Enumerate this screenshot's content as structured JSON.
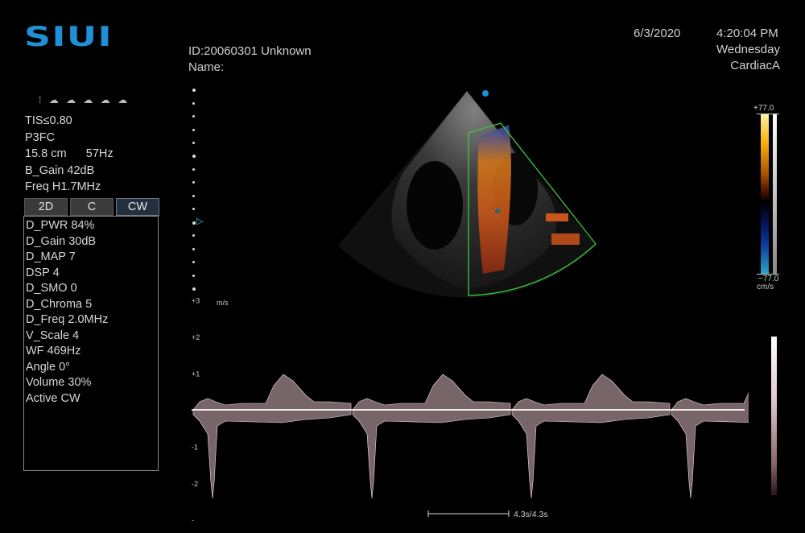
{
  "brand": {
    "logo_text": "SIUI"
  },
  "patient": {
    "id_line": "ID:20060301   Unknown",
    "name_line": "Name:"
  },
  "datetime": {
    "date": "6/3/2020",
    "time": "4:20:04 PM",
    "weekday": "Wednesday",
    "preset": "CardiacA"
  },
  "status_icons": [
    "probe-icon",
    "cloud-icon",
    "cloud-icon",
    "cloud-icon",
    "cloud-icon"
  ],
  "image_params": [
    "TIS≤0.80",
    "P3FC",
    "15.8 cm      57Hz",
    "B_Gain 42dB",
    "Freq H1.7MHz"
  ],
  "mode_tabs": [
    {
      "label": "2D",
      "active": false
    },
    {
      "label": "C",
      "active": false
    },
    {
      "label": "CW",
      "active": true
    }
  ],
  "doppler_params": [
    "D_PWR 84%",
    "D_Gain 30dB",
    "D_MAP 7",
    "DSP 4",
    "D_SMO 0",
    "D_Chroma 5",
    "D_Freq 2.0MHz",
    "V_Scale 4",
    "WF 469Hz",
    "Angle 0°",
    "Volume 30%",
    "Active CW"
  ],
  "color_scale": {
    "top": "+77.0",
    "bottom": "−77.0",
    "unit": "cm/s"
  },
  "spectrum": {
    "unit": "m/s",
    "ticks": [
      {
        "label": "+3",
        "value": 3
      },
      {
        "label": "+2",
        "value": 2
      },
      {
        "label": "+1",
        "value": 1
      },
      {
        "label": "-1",
        "value": -1
      },
      {
        "label": "-2",
        "value": -2
      },
      {
        "label": "-",
        "value": -3
      }
    ],
    "sweep_label": "4.3s/4.3s"
  },
  "colors": {
    "logo": "#1f8fd6",
    "roi": "#3ec83e",
    "baseline": "#ffffff",
    "marker": "#33d6e0"
  }
}
